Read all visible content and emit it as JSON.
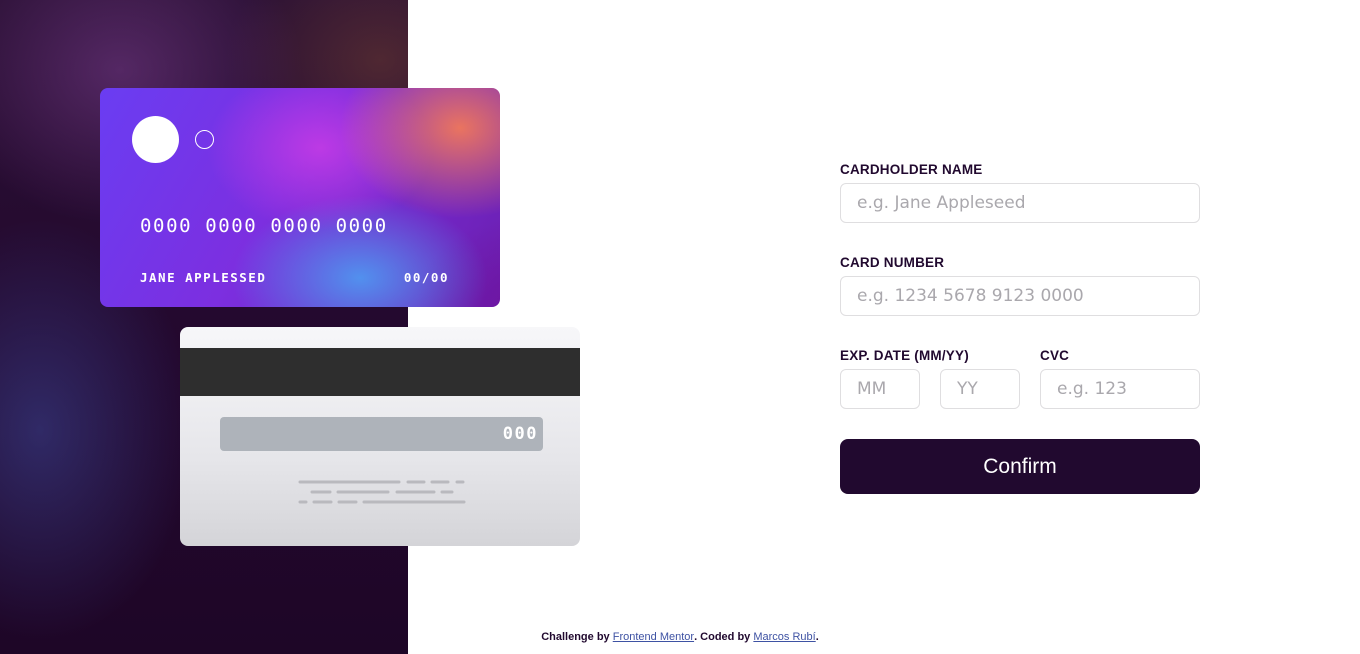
{
  "card_front": {
    "number": "0000 0000 0000 0000",
    "name": "JANE APPLESSED",
    "expiry": "00/00"
  },
  "card_back": {
    "cvc": "000"
  },
  "form": {
    "cardholder_label": "CARDHOLDER NAME",
    "cardholder_placeholder": "e.g. Jane Appleseed",
    "number_label": "CARD NUMBER",
    "number_placeholder": "e.g. 1234 5678 9123 0000",
    "exp_label": "EXP. DATE (MM/YY)",
    "month_placeholder": "MM",
    "year_placeholder": "YY",
    "cvc_label": "CVC",
    "cvc_placeholder": "e.g. 123",
    "confirm_label": "Confirm"
  },
  "footer": {
    "prefix": "Challenge by",
    "mentor_link": "Frontend Mentor",
    "middle": ". Coded by",
    "author_link": "Marcos Rubí",
    "suffix": "."
  },
  "colors": {
    "dark": "#21092f",
    "input_border": "#dfdee0",
    "placeholder": "#aaa8ad",
    "link": "#3e52a3"
  }
}
